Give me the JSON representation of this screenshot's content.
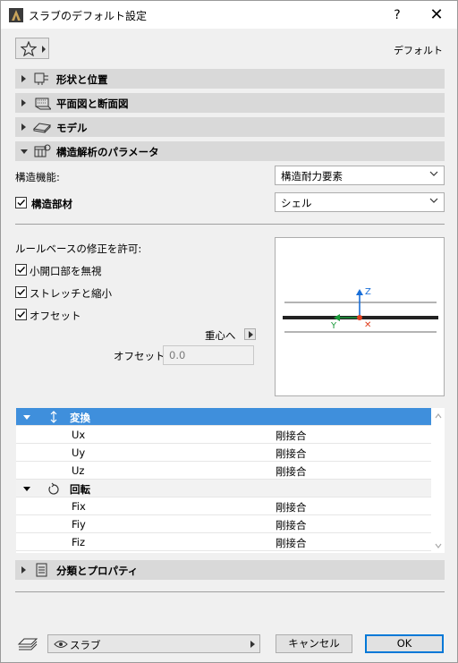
{
  "window": {
    "title": "スラブのデフォルト設定",
    "help_label": "?",
    "close_label": "✕"
  },
  "header": {
    "default_label": "デフォルト"
  },
  "sections": [
    {
      "label": "形状と位置",
      "icon": "shape-position-icon",
      "expanded": false
    },
    {
      "label": "平面図と断面図",
      "icon": "floorplan-section-icon",
      "expanded": false
    },
    {
      "label": "モデル",
      "icon": "model-icon",
      "expanded": false
    },
    {
      "label": "構造解析のパラメータ",
      "icon": "structural-analysis-icon",
      "expanded": true
    },
    {
      "label": "分類とプロパティ",
      "icon": "classification-icon",
      "expanded": false
    }
  ],
  "structural": {
    "function_label": "構造機能:",
    "function_value": "構造耐力要素",
    "member_label": "構造部材",
    "member_checked": true,
    "member_value": "シェル",
    "rules_label": "ルールベースの修正を許可:",
    "checkboxes": [
      {
        "label": "小開口部を無視",
        "checked": true
      },
      {
        "label": "ストレッチと縮小",
        "checked": true
      },
      {
        "label": "オフセット",
        "checked": true
      }
    ],
    "center_label": "重心へ",
    "offset_label": "オフセット:",
    "offset_value": "0.0"
  },
  "preview": {
    "z_label": "Z",
    "y_label": "Y",
    "x_label": "✕",
    "colors": {
      "z": "#1a6fd8",
      "y": "#1a9a3a",
      "x": "#e04020"
    }
  },
  "tree": {
    "groups": [
      {
        "label": "変換",
        "icon": "translation-icon",
        "selected": true,
        "rows": [
          {
            "name": "Ux",
            "value": "剛接合"
          },
          {
            "name": "Uy",
            "value": "剛接合"
          },
          {
            "name": "Uz",
            "value": "剛接合"
          }
        ]
      },
      {
        "label": "回転",
        "icon": "rotation-icon",
        "selected": false,
        "rows": [
          {
            "name": "Fix",
            "value": "剛接合"
          },
          {
            "name": "Fiy",
            "value": "剛接合"
          },
          {
            "name": "Fiz",
            "value": "剛接合"
          }
        ]
      }
    ]
  },
  "footer": {
    "layer_value": "スラブ",
    "cancel_label": "キャンセル",
    "ok_label": "OK"
  },
  "colors": {
    "selection": "#3f8fdc",
    "ok_border": "#0078d7"
  }
}
